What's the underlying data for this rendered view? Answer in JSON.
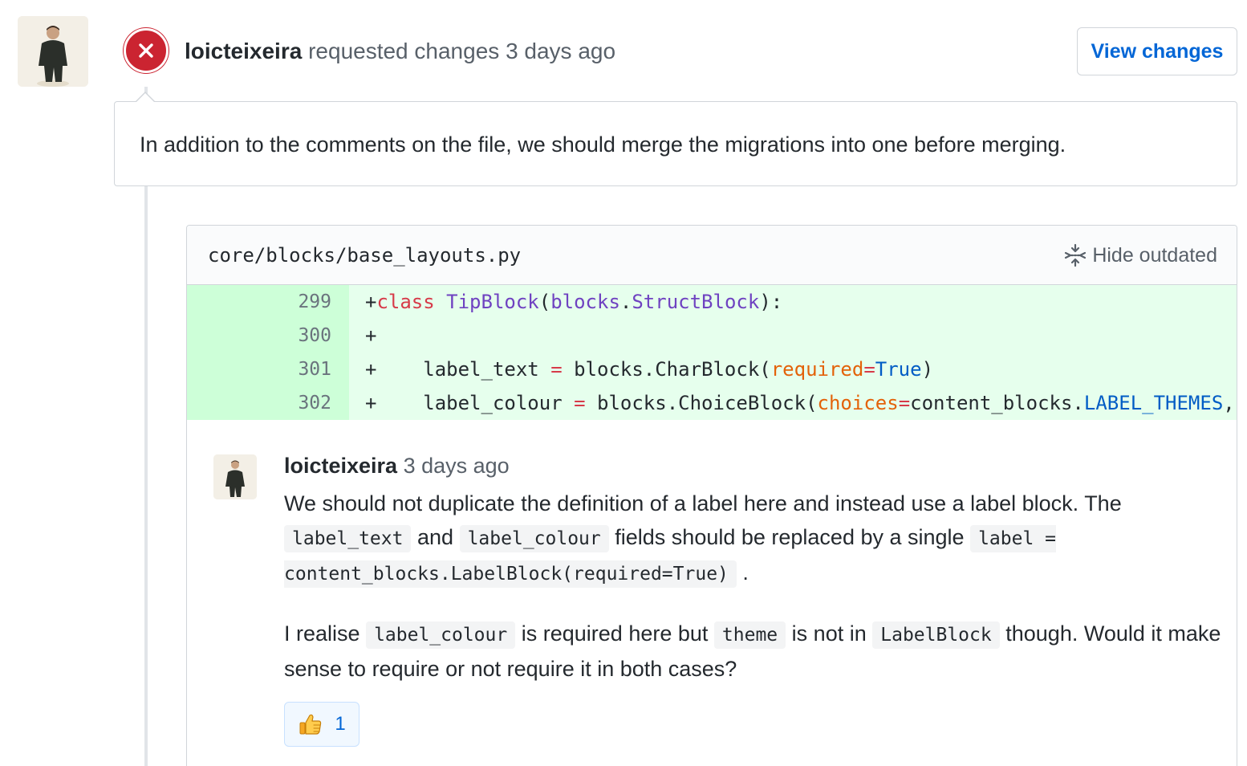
{
  "review": {
    "author": "loicteixeira",
    "action": "requested changes",
    "time": "3 days ago",
    "view_changes_label": "View changes",
    "body": "In addition to the comments on the file, we should merge the migrations into one before merging."
  },
  "file": {
    "path": "core/blocks/base_layouts.py",
    "hide_outdated_label": "Hide outdated",
    "lines": [
      {
        "num": "299",
        "code": "+class TipBlock(blocks.StructBlock):"
      },
      {
        "num": "300",
        "code": "+"
      },
      {
        "num": "301",
        "code": "+    label_text = blocks.CharBlock(required=True)"
      },
      {
        "num": "302",
        "code": "+    label_colour = blocks.ChoiceBlock(choices=content_blocks.LABEL_THEMES,"
      }
    ]
  },
  "comment": {
    "author": "loicteixeira",
    "time": "3 days ago",
    "p1": {
      "t1": "We should not duplicate the definition of a label here and instead use a label block. The",
      "c1": "label_text",
      "t2": "and",
      "c2": "label_colour",
      "t3": "fields should be replaced by a single",
      "c3": "label = content_blocks.LabelBlock(required=True)",
      "t4": "."
    },
    "p2": {
      "t1": "I realise",
      "c1": "label_colour",
      "t2": "is required here but",
      "c2": "theme",
      "t3": "is not in",
      "c3": "LabelBlock",
      "t4": "though. Would it make sense to require or not require it in both cases?"
    },
    "reaction": {
      "icon": "thumbs-up-icon",
      "count": "1"
    }
  },
  "colors": {
    "danger": "#cb2431",
    "link": "#0366d6",
    "diff_add_bg": "#e6ffed",
    "diff_add_num_bg": "#cdffd8"
  }
}
